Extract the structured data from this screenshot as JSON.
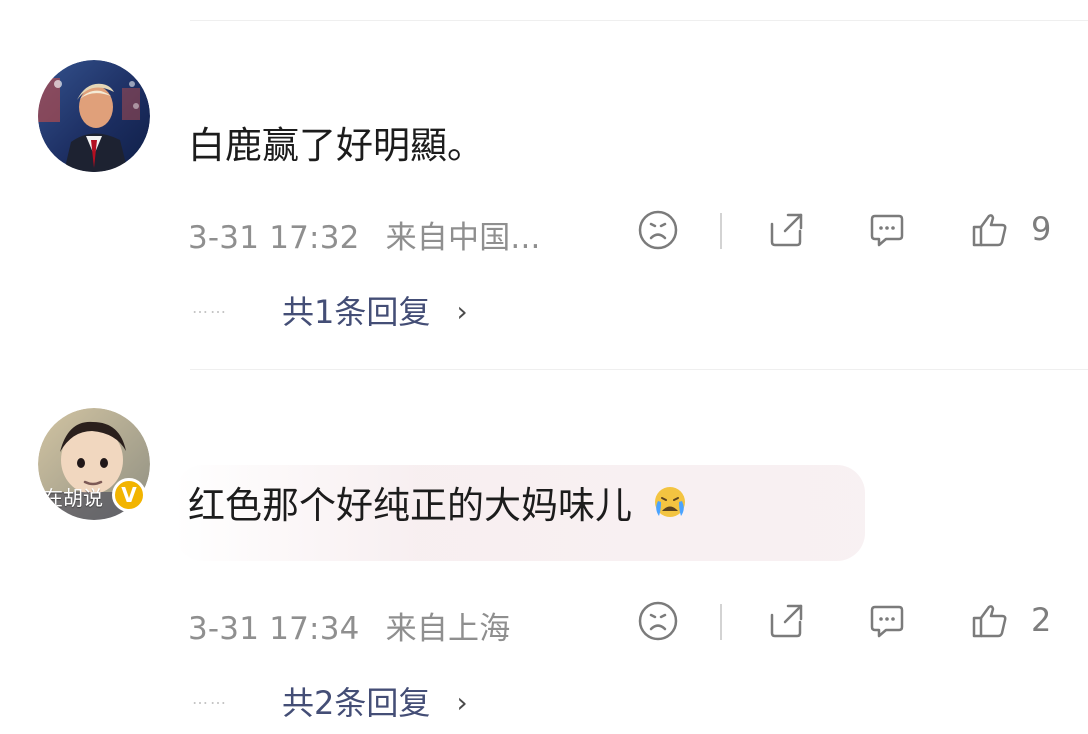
{
  "comments": [
    {
      "text": "白鹿赢了好明顯。",
      "time": "3-31 17:32",
      "location": "来自中国...",
      "like_count": "9",
      "replies_label": "共1条回复",
      "avatar": "avatar-image",
      "icons": {
        "dislike": "sad-face-icon",
        "share": "share-icon",
        "comment": "comment-icon",
        "like": "thumb-up-icon"
      }
    },
    {
      "text": "红色那个好纯正的大妈味儿",
      "emoji": "crying-face-emoji",
      "time": "3-31 17:34",
      "location": "来自上海",
      "like_count": "2",
      "replies_label": "共2条回复",
      "avatar": "avatar-image",
      "avatar_overlay_text": "在胡说",
      "verified_badge": "V",
      "icons": {
        "dislike": "sad-face-icon",
        "share": "share-icon",
        "comment": "comment-icon",
        "like": "thumb-up-icon"
      }
    }
  ],
  "colors": {
    "link": "#444e76",
    "meta": "#8f8f8f",
    "badge": "#f2b400",
    "emoji": "#f3c441",
    "tears": "#4aa3ff"
  }
}
